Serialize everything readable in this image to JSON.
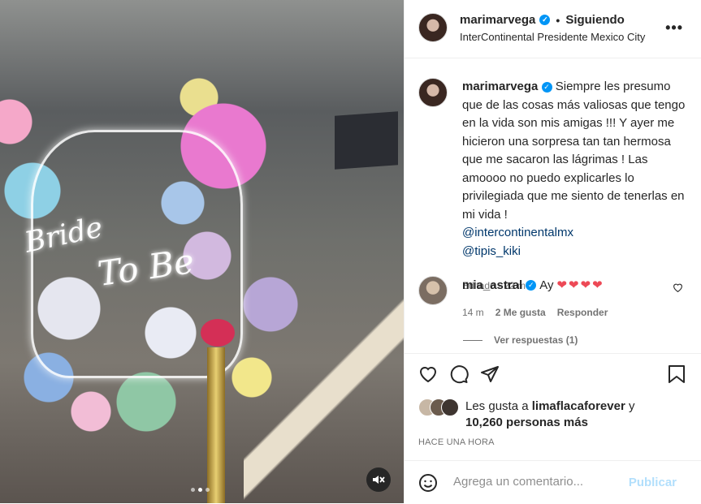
{
  "media": {
    "neon_line1": "Bride",
    "neon_line2": "To Be",
    "mute_icon": "volume-muted-icon"
  },
  "post": {
    "username": "marimarvega",
    "separator": "•",
    "follow_status": "Siguiendo",
    "location": "InterContinental Presidente Mexico City",
    "more_icon": "more-horizontal-icon",
    "caption": {
      "username": "marimarvega",
      "text": "Siempre les presumo que de las cosas más valiosas que tengo en la vida son mis amigas !!! Y ayer me hicieron una sorpresa tan tan hermosa que me sacaron las lágrimas ! Las amoooo no puedo explicarles lo privilegiada que me siento de tenerlas en mi vida !",
      "mention1": "@intercontinentalmx",
      "mention2": "@tipis_kiki",
      "edited": "Editado · 22 m"
    },
    "comment": {
      "username": "mia_astral",
      "text": "Ay",
      "hearts": "❤❤❤❤",
      "time": "14 m",
      "likes": "2 Me gusta",
      "reply": "Responder",
      "view_replies": "Ver respuestas (1)"
    },
    "likes": {
      "prefix": "Les gusta a",
      "user": "limaflacaforever",
      "connector": "y",
      "count": "10,260 personas más"
    },
    "timestamp": "HACE UNA HORA",
    "composer": {
      "placeholder": "Agrega un comentario...",
      "publish": "Publicar"
    }
  },
  "colors": {
    "verified": "#0095f6",
    "link": "#00376b",
    "publish_disabled": "#b2dffc",
    "heart": "#ed4956"
  }
}
